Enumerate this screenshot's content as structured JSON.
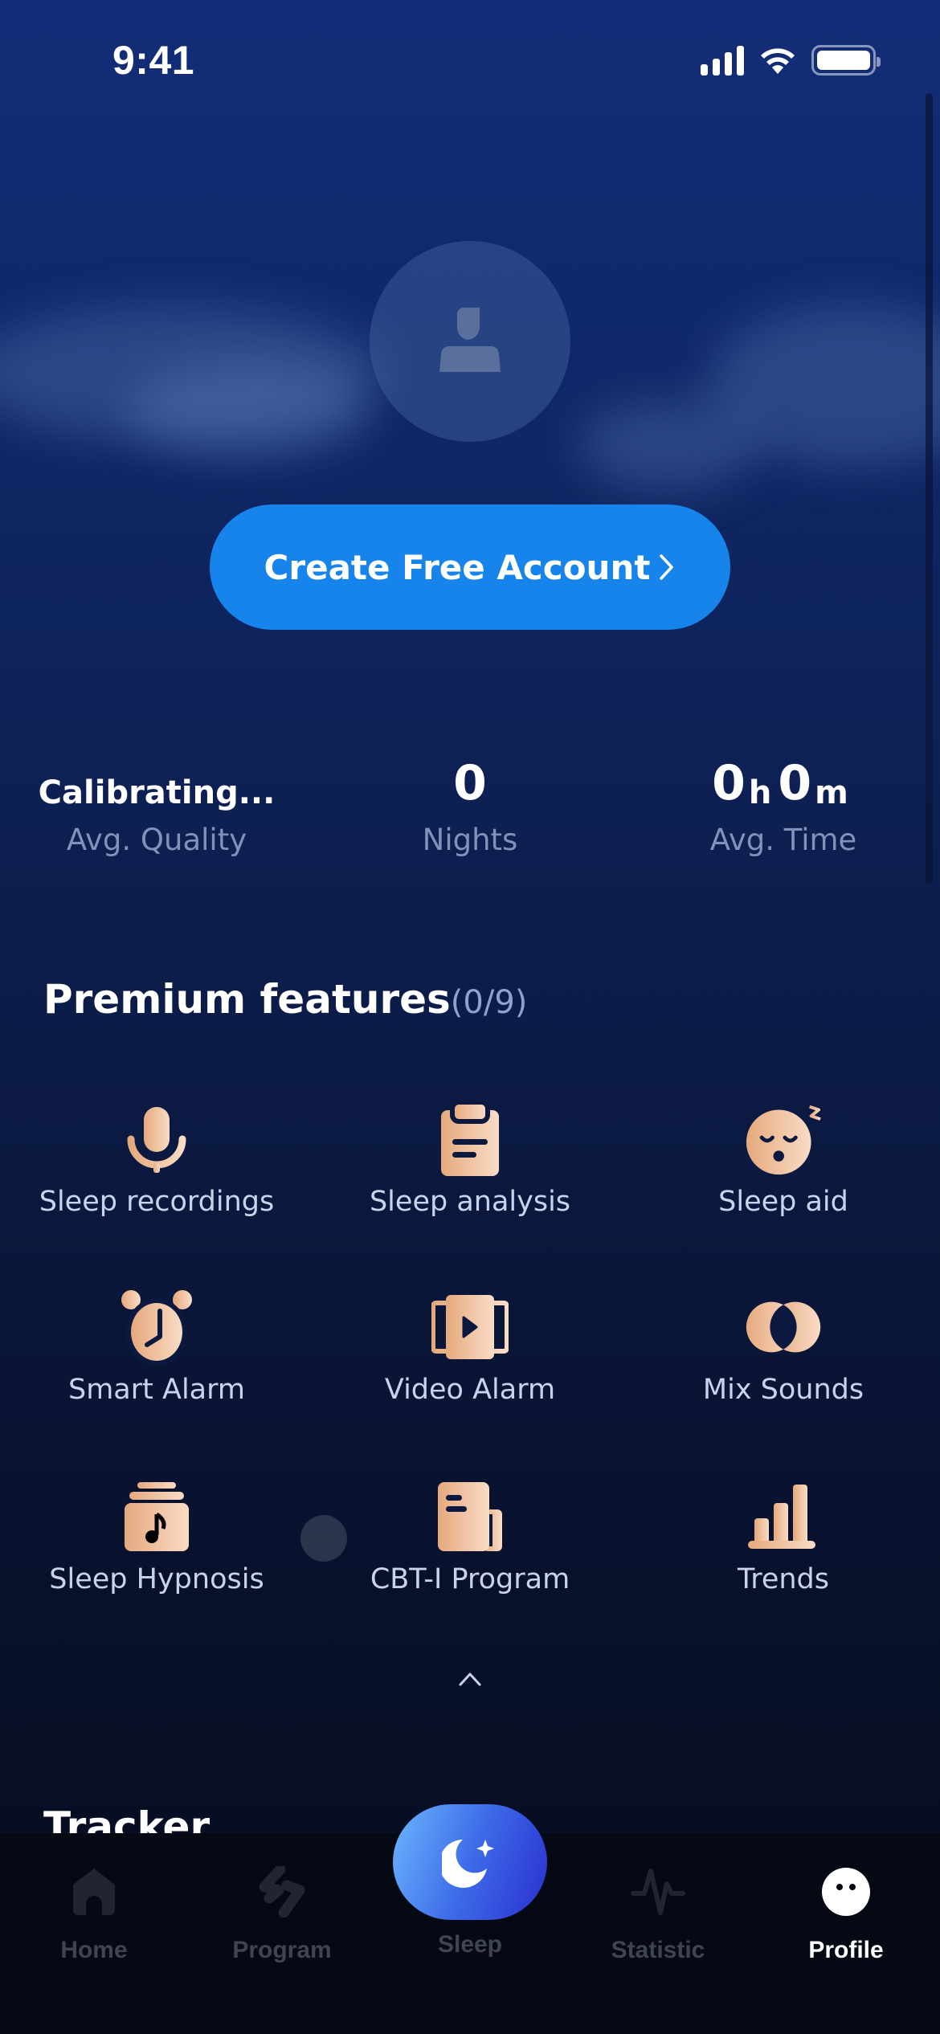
{
  "status_bar": {
    "time": "9:41",
    "icons": [
      "cellular-signal-icon",
      "wifi-icon",
      "battery-icon"
    ]
  },
  "profile": {
    "avatar_icon": "user-silhouette-icon",
    "cta_label": "Create Free Account",
    "cta_icon": "chevron-right-icon",
    "cta_color": "#1784ec"
  },
  "stats": [
    {
      "value": "Calibrating...",
      "label": "Avg. Quality"
    },
    {
      "value": "0",
      "label": "Nights"
    },
    {
      "hours": "0",
      "hours_unit": "h",
      "minutes": "0",
      "minutes_unit": "m",
      "label": "Avg. Time"
    }
  ],
  "premium": {
    "title": "Premium features",
    "count": "(0/9)",
    "icon_color": "#f0c6a2",
    "features": [
      {
        "label": "Sleep recordings",
        "icon": "microphone-icon"
      },
      {
        "label": "Sleep analysis",
        "icon": "clipboard-icon"
      },
      {
        "label": "Sleep aid",
        "icon": "sleepy-face-icon"
      },
      {
        "label": "Smart Alarm",
        "icon": "alarm-clock-icon"
      },
      {
        "label": "Video Alarm",
        "icon": "video-play-icon"
      },
      {
        "label": "Mix Sounds",
        "icon": "overlapping-circles-icon"
      },
      {
        "label": "Sleep Hypnosis",
        "icon": "music-jar-icon"
      },
      {
        "label": "CBT-I Program",
        "icon": "document-mug-icon"
      },
      {
        "label": "Trends",
        "icon": "bar-chart-icon"
      }
    ],
    "collapse_icon": "chevron-up-icon"
  },
  "tracker": {
    "title": "Tracker"
  },
  "tab_bar": {
    "active": "Profile",
    "tabs": [
      {
        "label": "Home",
        "icon": "home-icon"
      },
      {
        "label": "Program",
        "icon": "program-bolt-icon"
      },
      {
        "label": "Sleep",
        "icon": "moon-star-icon"
      },
      {
        "label": "Statistic",
        "icon": "pulse-icon"
      },
      {
        "label": "Profile",
        "icon": "profile-face-icon"
      }
    ]
  }
}
